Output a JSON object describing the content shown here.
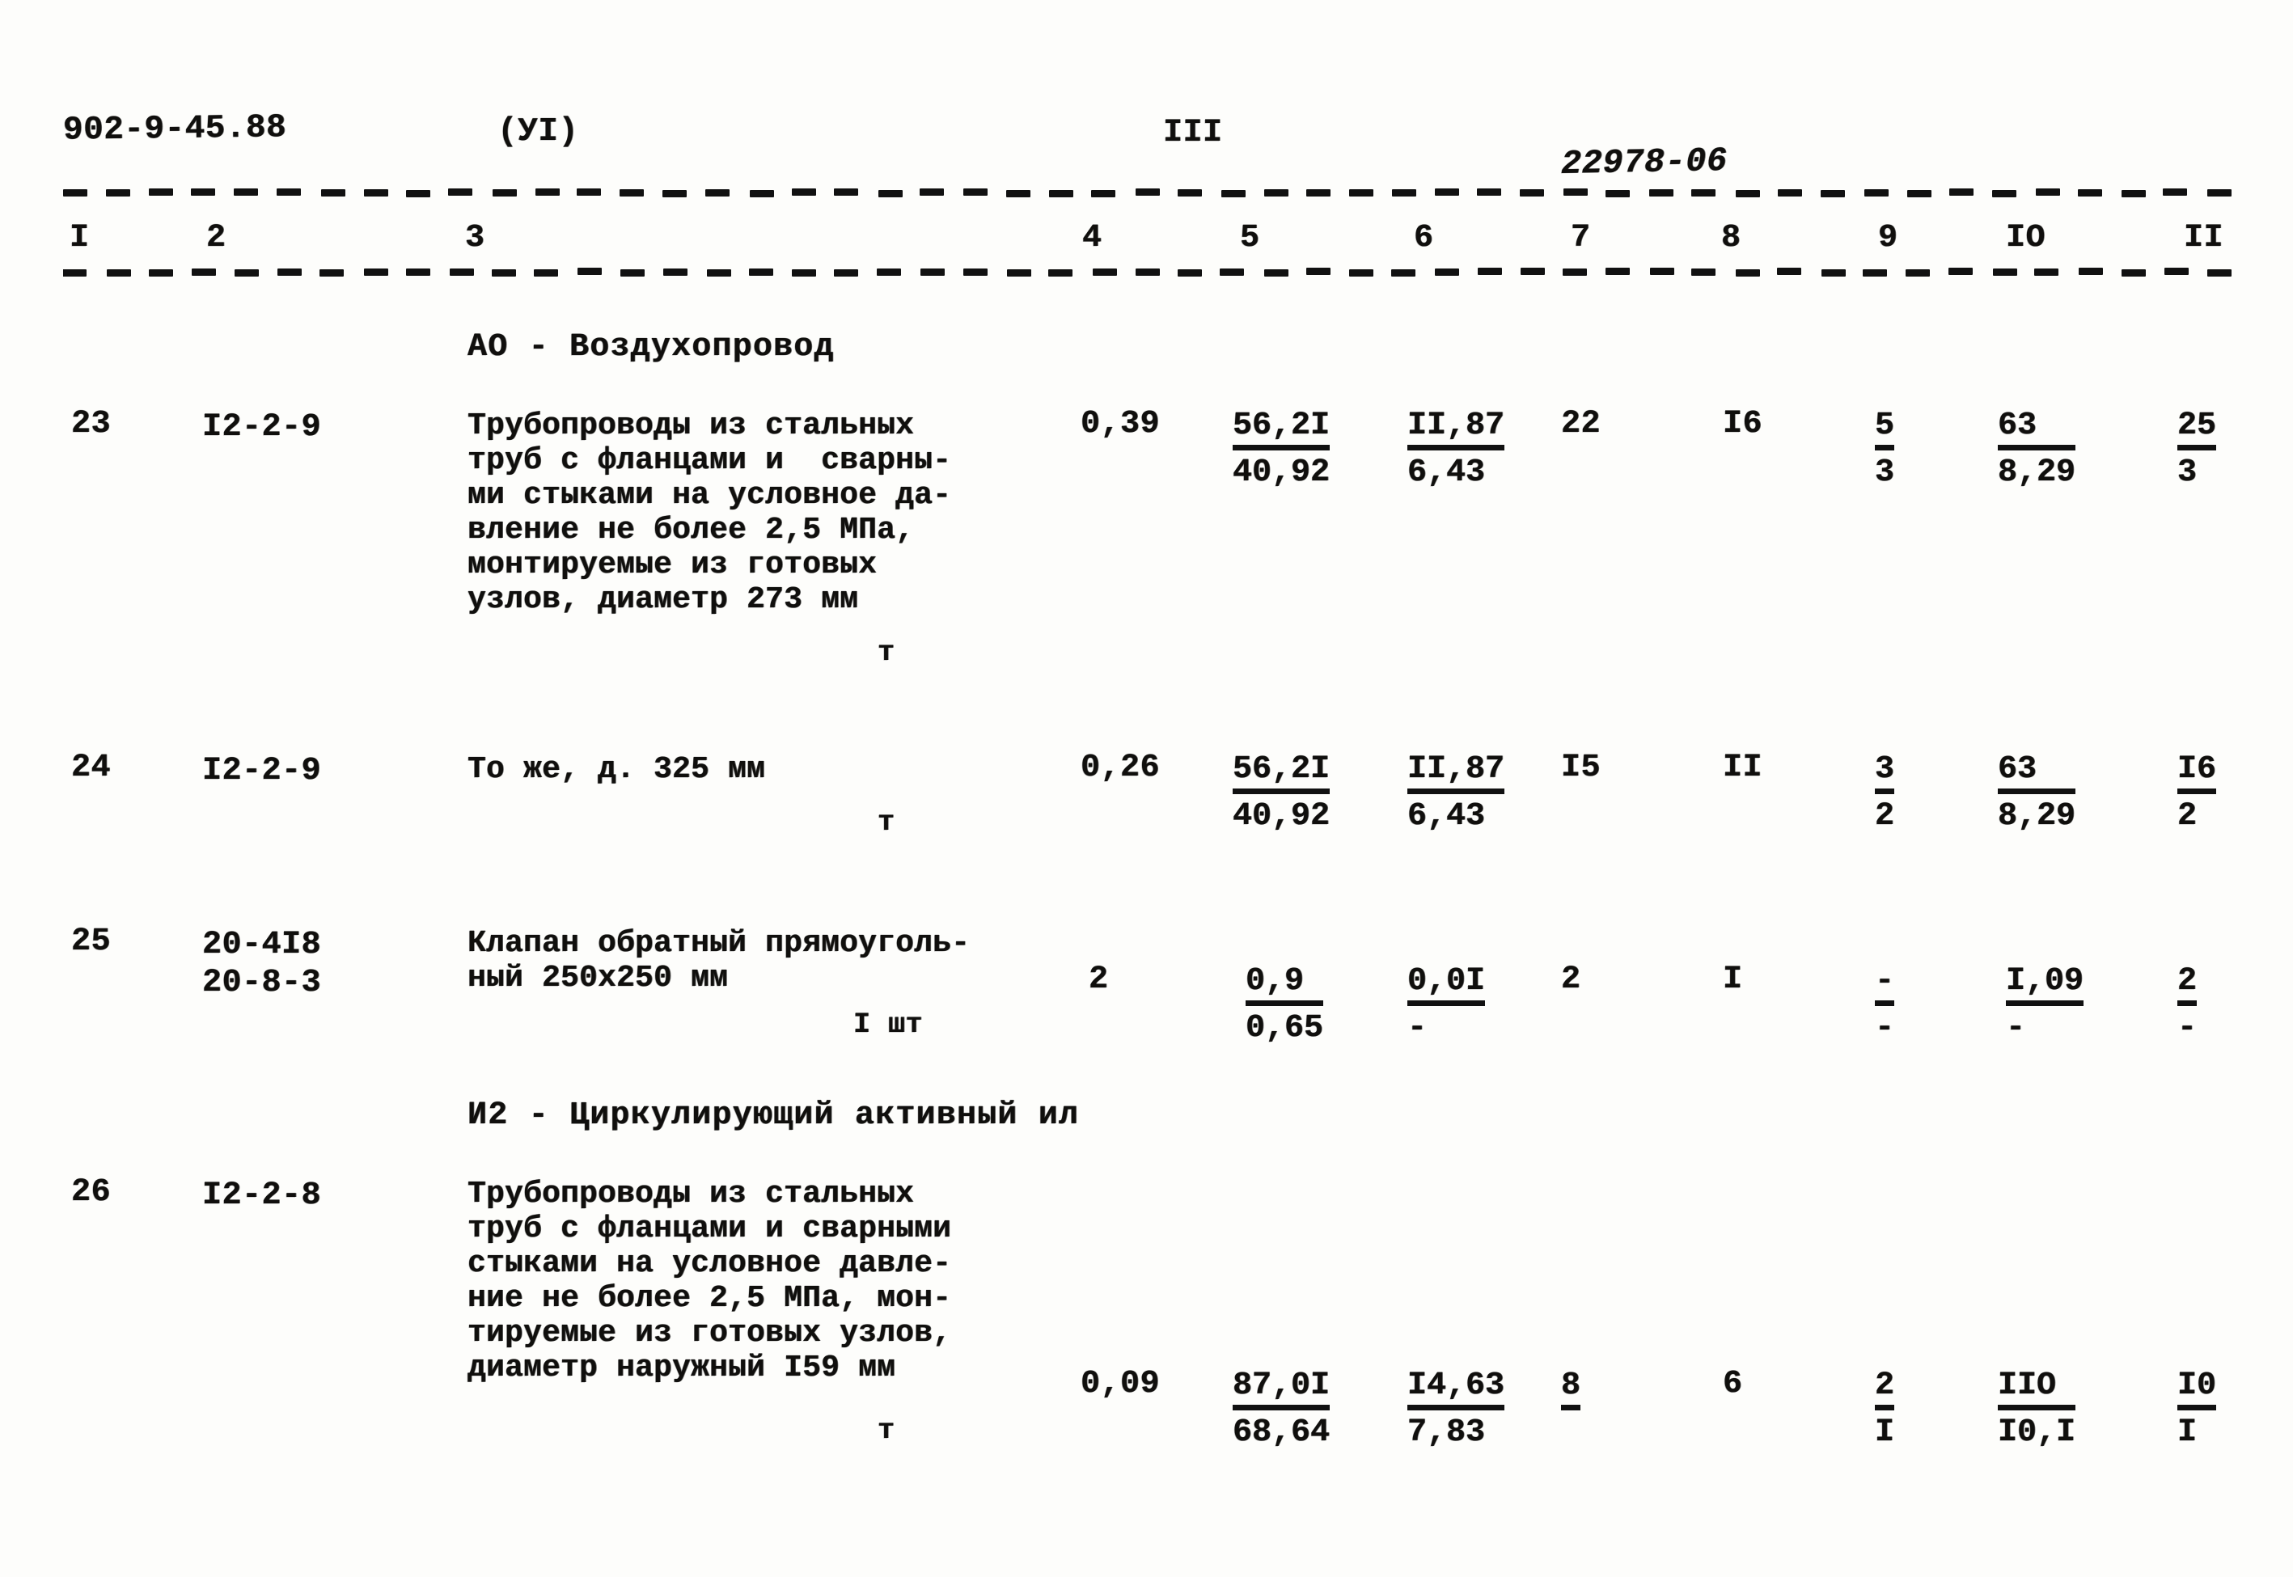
{
  "header": {
    "doc_code": "902-9-45.88",
    "variant": "(УI)",
    "sheet_roman": "III",
    "doc_serial": "22978-06"
  },
  "columns": [
    "I",
    "2",
    "3",
    "4",
    "5",
    "6",
    "7",
    "8",
    "9",
    "IO",
    "II"
  ],
  "sections": [
    {
      "caption": "АО - Воздухопровод"
    },
    {
      "caption": "И2 - Циркулирующий активный ил"
    }
  ],
  "rows": [
    {
      "index": "23",
      "code": "I2-2-9",
      "desc": "Трубопроводы из стальных\nтруб с фланцами и  сварны-\nми стыками на условное да-\nвление не более 2,5 МПа,\nмонтируемые из готовых\nузлов, диаметр 273 мм",
      "unit": "т",
      "c4": "0,39",
      "c5_top": "56,2I",
      "c5_bot": "40,92",
      "c6_top": "II,87",
      "c6_bot": "6,43",
      "c7": "22",
      "c8": "I6",
      "c9_top": "5",
      "c9_bot": "3",
      "c10_top": "63",
      "c10_bot": "8,29",
      "c11_top": "25",
      "c11_bot": "3"
    },
    {
      "index": "24",
      "code": "I2-2-9",
      "desc": "То же, д. 325 мм",
      "unit": "т",
      "c4": "0,26",
      "c5_top": "56,2I",
      "c5_bot": "40,92",
      "c6_top": "II,87",
      "c6_bot": "6,43",
      "c7": "I5",
      "c8": "II",
      "c9_top": "3",
      "c9_bot": "2",
      "c10_top": "63",
      "c10_bot": "8,29",
      "c11_top": "I6",
      "c11_bot": "2"
    },
    {
      "index": "25",
      "code": "20-4I8\n20-8-3",
      "desc": "Клапан обратный прямоуголь-\nный 250х250 мм",
      "unit": "I шт",
      "c4": "2",
      "c5_top": "0,9",
      "c5_bot": "0,65",
      "c6_top": "0,0I",
      "c6_bot": "-",
      "c7": "2",
      "c8": "I",
      "c9_top": "-",
      "c9_bot": "-",
      "c10_top": "I,09",
      "c10_bot": "-",
      "c11_top": "2",
      "c11_bot": "-"
    },
    {
      "index": "26",
      "code": "I2-2-8",
      "desc": "Трубопроводы из стальных\nтруб с фланцами и сварными\nстыками на условное давле-\nние не более 2,5 МПа, мон-\nтируемые из готовых узлов,\nдиаметр наружный I59 мм",
      "unit": "т",
      "c4": "0,09",
      "c5_top": "87,0I",
      "c5_bot": "68,64",
      "c6_top": "I4,63",
      "c6_bot": "7,83",
      "c7": "8",
      "c8": "6",
      "c9_top": "2",
      "c9_bot": "I",
      "c10_top": "IIO",
      "c10_bot": "I0,I",
      "c11_top": "I0",
      "c11_bot": "I"
    }
  ]
}
